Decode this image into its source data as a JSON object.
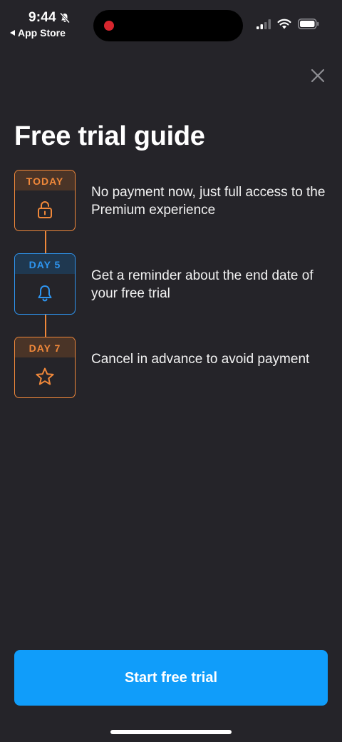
{
  "status_bar": {
    "time": "9:44",
    "back_label": "App Store"
  },
  "title": "Free trial guide",
  "steps": [
    {
      "badge": "TODAY",
      "text": "No payment now, just full access to the Premium experience",
      "icon": "unlock-icon",
      "color": "#f0883a"
    },
    {
      "badge": "DAY 5",
      "text": "Get a reminder about the end date of your free trial",
      "icon": "bell-icon",
      "color": "#2e95f0"
    },
    {
      "badge": "DAY 7",
      "text": "Cancel in advance to avoid payment",
      "icon": "star-icon",
      "color": "#f0883a"
    }
  ],
  "cta": {
    "label": "Start free trial",
    "color": "#109dfa"
  }
}
